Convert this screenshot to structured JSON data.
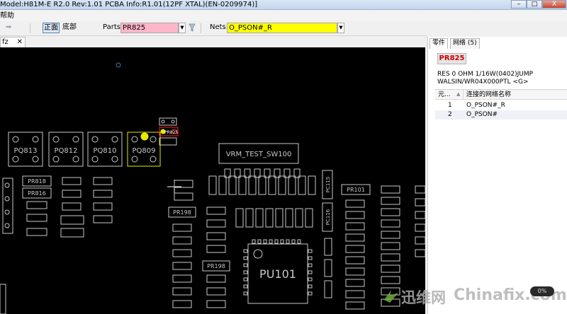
{
  "window": {
    "title": "Model:H81M-E R2.0 Rev:1.01 PCBA Info:R1.01(12PF XTAL)(EN-0209974)]",
    "min_label": "–",
    "max_label": "□",
    "close_label": "X"
  },
  "menu": {
    "help": "帮助"
  },
  "toolbar": {
    "nav_arrow": "➡",
    "side_front": "正面",
    "side_back": "底部",
    "parts_label": "Parts:",
    "parts_value": "PR825",
    "nets_label": "Nets:",
    "nets_value": "O_PSON#_R"
  },
  "doc_tab": {
    "label": "fz",
    "close": "✕"
  },
  "board": {
    "components": [
      "PQ813",
      "PQ812",
      "PQ810",
      "PQ809",
      "VRM_TEST_SW100",
      "PU101",
      "PR818",
      "PR816",
      "PR825",
      "PR101",
      "PR198",
      "PR198",
      "PC115",
      "PC116"
    ],
    "highlight_color": "#ffff00",
    "selected_color": "#ff2020"
  },
  "right_panel": {
    "tab_parts": "零件",
    "tab_nets": "网络 (5)",
    "part_name": "PR825",
    "desc_line1": "RES 0 OHM 1/16W(0402)JUMP",
    "desc_line2": "WALSIN/WR04X000PTL       <G>",
    "col_pin": "元...",
    "col_net": "连接的网络名称",
    "rows": [
      {
        "pin": "1",
        "net": "O_PSON#_R"
      },
      {
        "pin": "2",
        "net": "O_PSON#"
      }
    ]
  },
  "watermark": {
    "brand_cn": "迅维网",
    "brand_en": "Chinafix.com"
  },
  "zoom_label": "0%"
}
